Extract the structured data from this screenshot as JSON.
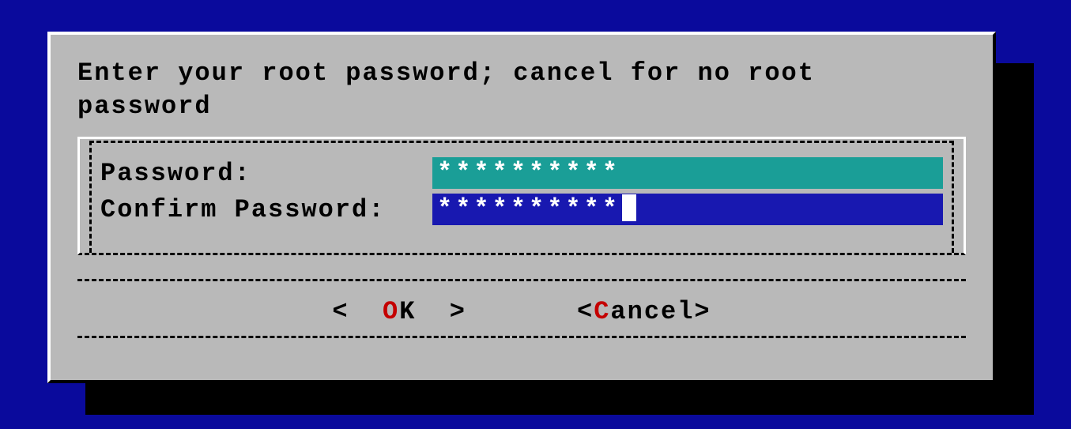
{
  "dialog": {
    "prompt": "Enter your root password; cancel for no root\npassword",
    "fields": {
      "password": {
        "label": "Password:",
        "masked_value": "**********"
      },
      "confirm": {
        "label": "Confirm Password:",
        "masked_value": "**********",
        "focused": true
      }
    },
    "buttons": {
      "ok": {
        "angle_left": "<",
        "hot": "O",
        "rest": "K",
        "angle_right": ">",
        "selected": true
      },
      "cancel": {
        "angle_left": "<",
        "hot": "C",
        "rest": "ancel",
        "angle_right": ">"
      }
    }
  },
  "colors": {
    "background": "#0a0a9c",
    "dialog_bg": "#b9b9b9",
    "inactive_field": "#1a9e97",
    "active_field": "#1818b0",
    "hotkey": "#c40000"
  }
}
